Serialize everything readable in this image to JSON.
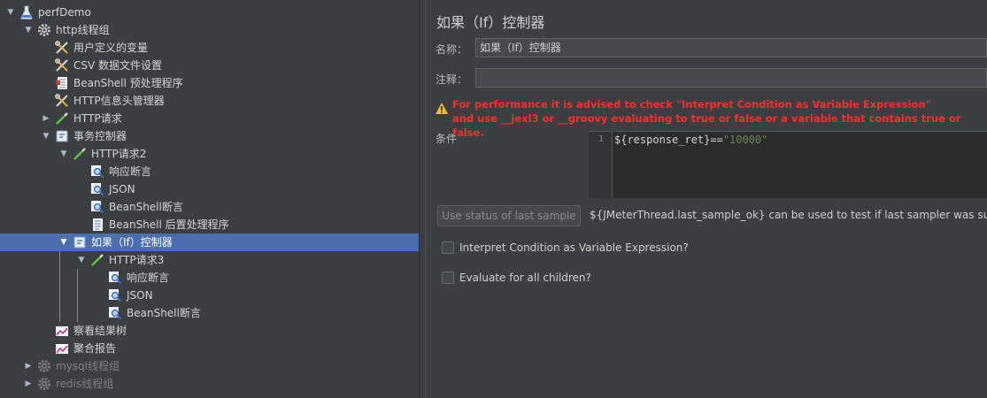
{
  "tree": {
    "items": [
      {
        "label": "perfDemo",
        "icon": "flask-icon",
        "toggle": "down",
        "state": "normal"
      },
      {
        "label": "http线程组",
        "icon": "gear-icon",
        "toggle": "down",
        "state": "normal"
      },
      {
        "label": "用户定义的变量",
        "icon": "wrench-icon",
        "toggle": "",
        "state": "normal"
      },
      {
        "label": "CSV 数据文件设置",
        "icon": "wrench-icon",
        "toggle": "",
        "state": "normal"
      },
      {
        "label": "BeanShell 预处理程序",
        "icon": "script-icon",
        "toggle": "",
        "state": "normal"
      },
      {
        "label": "HTTP信息头管理器",
        "icon": "wrench-icon",
        "toggle": "",
        "state": "normal"
      },
      {
        "label": "HTTP请求",
        "icon": "pipette-icon",
        "toggle": "right",
        "state": "normal"
      },
      {
        "label": "事务控制器",
        "icon": "controller-icon",
        "toggle": "down",
        "state": "normal"
      },
      {
        "label": "HTTP请求2",
        "icon": "pipette-icon",
        "toggle": "down",
        "state": "normal"
      },
      {
        "label": "响应断言",
        "icon": "magnifier-icon",
        "toggle": "",
        "state": "normal"
      },
      {
        "label": "JSON",
        "icon": "magnifier-icon",
        "toggle": "",
        "state": "normal"
      },
      {
        "label": "BeanShell断言",
        "icon": "magnifier-icon",
        "toggle": "",
        "state": "normal"
      },
      {
        "label": "BeanShell 后置处理程序",
        "icon": "document-icon",
        "toggle": "",
        "state": "normal"
      },
      {
        "label": "如果（If）控制器",
        "icon": "controller-icon",
        "toggle": "down",
        "state": "selected"
      },
      {
        "label": "HTTP请求3",
        "icon": "pipette-icon",
        "toggle": "down",
        "state": "normal"
      },
      {
        "label": "响应断言",
        "icon": "magnifier-icon",
        "toggle": "",
        "state": "normal"
      },
      {
        "label": "JSON",
        "icon": "magnifier-icon",
        "toggle": "",
        "state": "normal"
      },
      {
        "label": "BeanShell断言",
        "icon": "magnifier-icon",
        "toggle": "",
        "state": "normal"
      },
      {
        "label": "察看结果树",
        "icon": "graph-icon",
        "toggle": "",
        "state": "normal"
      },
      {
        "label": "聚合报告",
        "icon": "graph-icon",
        "toggle": "",
        "state": "normal"
      },
      {
        "label": "mysql线程组",
        "icon": "gear-icon",
        "toggle": "right",
        "state": "disabled"
      },
      {
        "label": "redis线程组",
        "icon": "gear-icon",
        "toggle": "right",
        "state": "disabled"
      }
    ]
  },
  "panel": {
    "title": "如果（If）控制器",
    "name_label": "名称：",
    "name_value": "如果（If）控制器",
    "comment_label": "注释：",
    "comment_value": "",
    "warning_line1": "For performance it is advised to check \"Interpret Condition as Variable Expression\"",
    "warning_line2": "and use __jexl3 or __groovy evaluating to true or false or a variable that contains true or false.",
    "condition_label": "条件",
    "line_number": "1",
    "code_prefix": "${response_ret}==",
    "code_string": "\"10000\"",
    "button_label": "Use status of last sample",
    "hint": "${JMeterThread.last_sample_ok} can be used to test if last sampler was successful",
    "checkbox1_label": "Interpret Condition as Variable Expression?",
    "checkbox2_label": "Evaluate for all children?"
  },
  "colors": {
    "background": "#3c3f41",
    "selected": "#4b6eaf",
    "warning": "#ff2a2a",
    "code_string": "#6a8759"
  }
}
